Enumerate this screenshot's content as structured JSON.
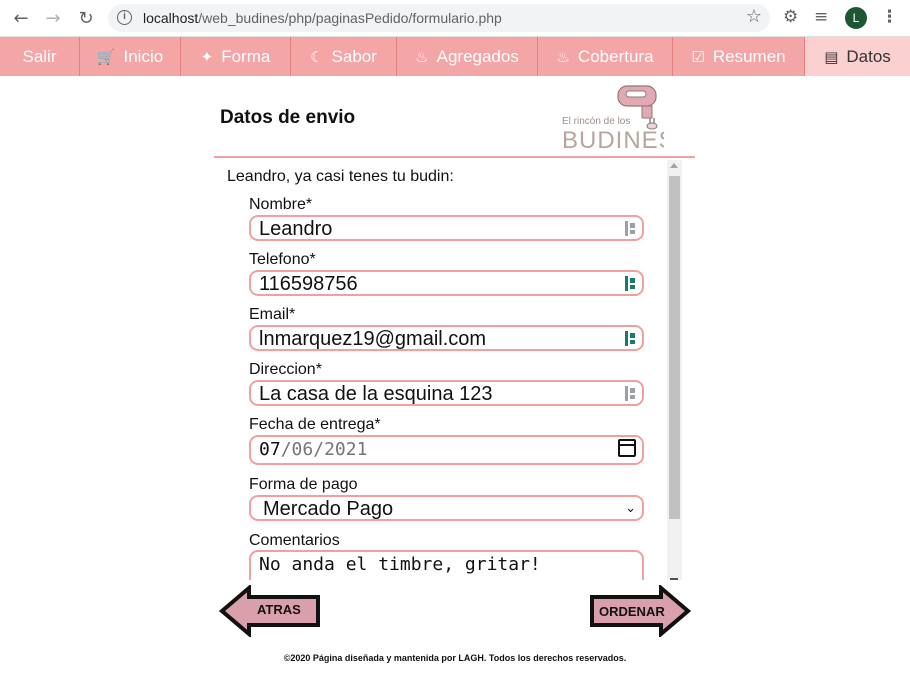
{
  "browser": {
    "url_host": "localhost",
    "url_path": "/web_budines/php/paginasPedido/formulario.php",
    "avatar_letter": "L"
  },
  "nav": {
    "items": [
      {
        "label": "Salir",
        "icon": "none"
      },
      {
        "label": "Inicio",
        "icon": "cart-icon"
      },
      {
        "label": "Forma",
        "icon": "magic-wand-icon"
      },
      {
        "label": "Sabor",
        "icon": "cookie-icon"
      },
      {
        "label": "Agregados",
        "icon": "fire-icon"
      },
      {
        "label": "Cobertura",
        "icon": "cake-icon"
      },
      {
        "label": "Resumen",
        "icon": "clipboard-check-icon"
      },
      {
        "label": "Datos",
        "icon": "document-icon"
      }
    ],
    "active": "Datos",
    "color": "#f4a5a5",
    "active_color": "#fbd0d0"
  },
  "header": {
    "title": "Datos de envio",
    "logo_text_top": "El rincón de los",
    "logo_text_main": "BUDINES"
  },
  "form": {
    "intro": "Leandro, ya casi tenes tu budin:",
    "nombre_label": "Nombre*",
    "nombre_value": "Leandro",
    "telefono_label": "Telefono*",
    "telefono_value": "116598756",
    "email_label": "Email*",
    "email_value": "lnmarquez19@gmail.com",
    "direccion_label": "Direccion*",
    "direccion_value": "La casa de la esquina 123",
    "fecha_label": "Fecha de entrega*",
    "fecha_day": "07",
    "fecha_month": "06",
    "fecha_year": "2021",
    "pago_label": "Forma de pago",
    "pago_value": "Mercado Pago",
    "comentarios_label": "Comentarios",
    "comentarios_value": "No anda el timbre, gritar!",
    "border_color": "#f1a0a0"
  },
  "buttons": {
    "back": "ATRAS",
    "order": "ORDENAR",
    "fill": "#d9a0ab"
  },
  "footer": {
    "text": "©2020 Página diseñada y mantenida por LAGH. Todos los derechos reservados."
  }
}
